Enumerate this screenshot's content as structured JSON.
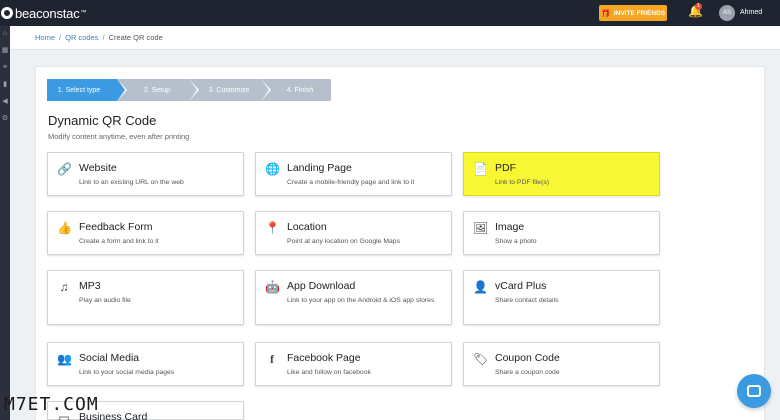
{
  "header": {
    "logo_text": "beaconstac",
    "logo_tm": "™",
    "invite_label": "INVITE FRIENDS",
    "bell_badge": "1",
    "avatar_initials": "AS",
    "username": "Ahmed"
  },
  "breadcrumb": {
    "home": "Home",
    "qr_codes": "QR codes",
    "current": "Create QR code",
    "separator": "/"
  },
  "steps": [
    {
      "label": "1. Select type",
      "active": true
    },
    {
      "label": "2. Setup",
      "active": false
    },
    {
      "label": "3. Customize",
      "active": false
    },
    {
      "label": "4. Finish",
      "active": false
    }
  ],
  "page": {
    "title": "Dynamic QR Code",
    "subtitle": "Modify content anytime, even after printing"
  },
  "cards": [
    {
      "name": "Website",
      "desc": "Link to an existing URL on the web",
      "icon": "link-icon"
    },
    {
      "name": "Landing Page",
      "desc": "Create a mobile-friendly page and link to it",
      "icon": "globe-icon"
    },
    {
      "name": "PDF",
      "desc": "Link to PDF file(s)",
      "icon": "pdf-icon",
      "highlighted": true
    },
    {
      "name": "Feedback Form",
      "desc": "Create a form and link to it",
      "icon": "thumbs-up-icon"
    },
    {
      "name": "Location",
      "desc": "Point at any location on Google Maps",
      "icon": "map-pin-icon"
    },
    {
      "name": "Image",
      "desc": "Show a photo",
      "icon": "image-icon"
    },
    {
      "name": "MP3",
      "desc": "Play an audio file",
      "icon": "music-icon"
    },
    {
      "name": "App Download",
      "desc": "Link to your app on the Android & iOS app stores",
      "icon": "android-icon"
    },
    {
      "name": "vCard Plus",
      "desc": "Share contact details",
      "icon": "user-icon"
    },
    {
      "name": "Social Media",
      "desc": "Link to your social media pages",
      "icon": "users-icon"
    },
    {
      "name": "Facebook Page",
      "desc": "Like and follow on facebook",
      "icon": "facebook-icon"
    },
    {
      "name": "Coupon Code",
      "desc": "Share a coupon code",
      "icon": "tag-icon"
    },
    {
      "name": "Business Card",
      "desc": "",
      "icon": "card-icon"
    }
  ],
  "watermark": "M7ET.COM",
  "colors": {
    "accent": "#3b9ae1",
    "topbar": "#1e2430",
    "invite": "#f5a623",
    "highlight": "#f7f733"
  }
}
